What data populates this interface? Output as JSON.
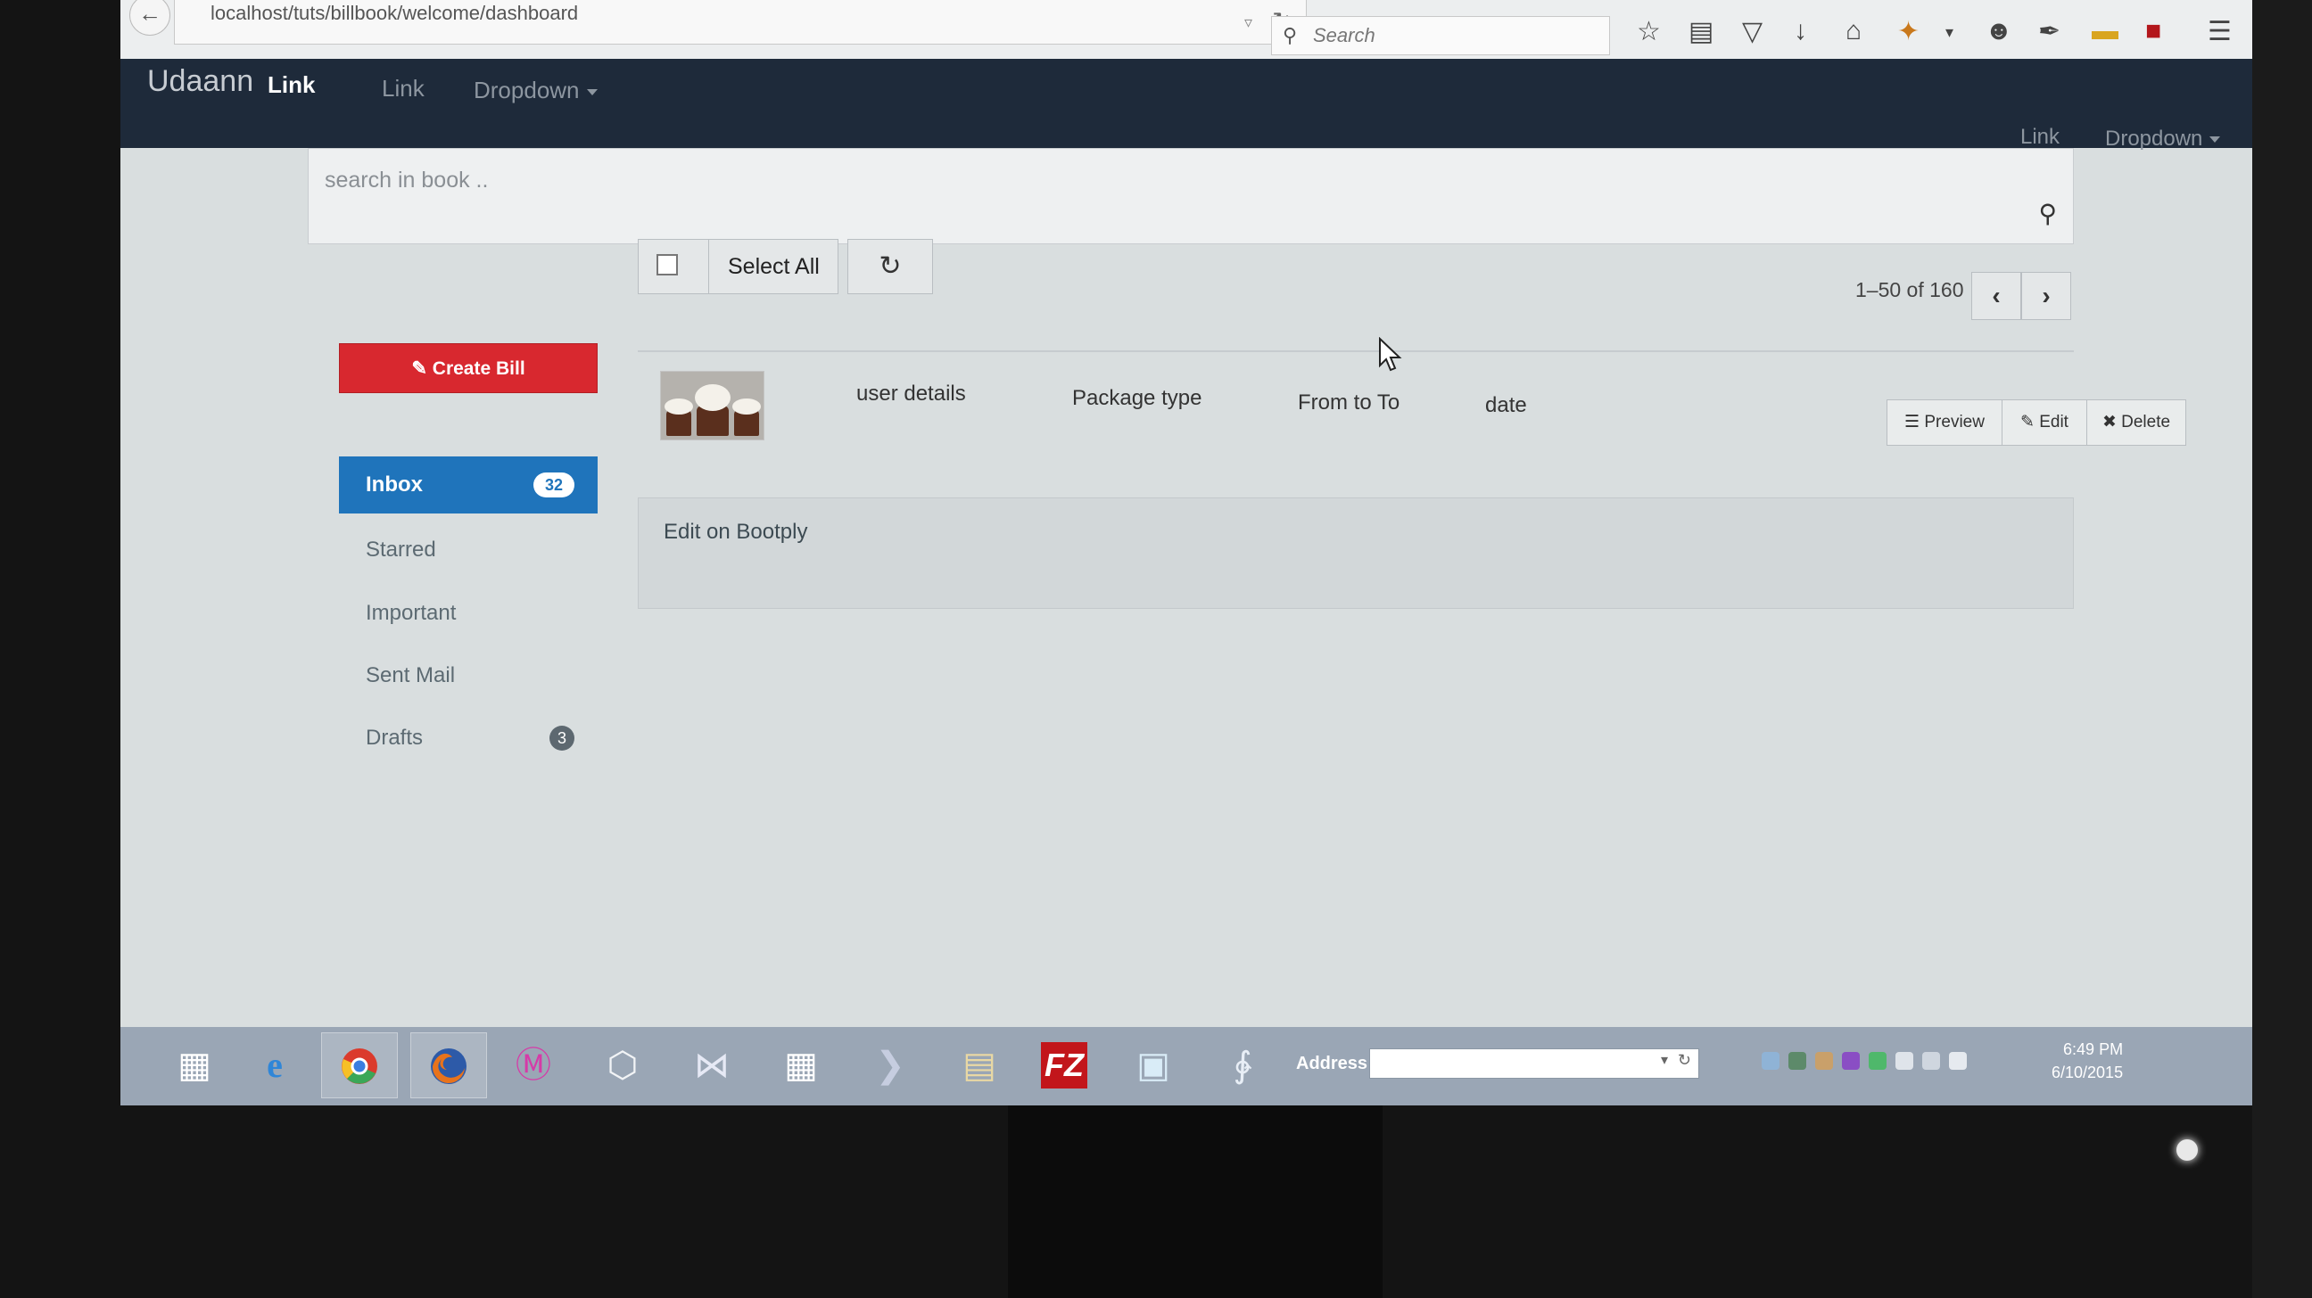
{
  "browser": {
    "url": "localhost/tuts/billbook/welcome/dashboard",
    "search_placeholder": "Search"
  },
  "navbar": {
    "brand": "Udaann",
    "links": [
      "Link",
      "Link"
    ],
    "dropdown": "Dropdown",
    "right_link": "Link",
    "right_dropdown": "Dropdown"
  },
  "search": {
    "placeholder": "search in book .."
  },
  "toolbar": {
    "select_all": "Select All",
    "pager_text": "1–50 of 160"
  },
  "sidebar": {
    "create_bill": "Create Bill",
    "items": [
      {
        "label": "Inbox",
        "badge": "32"
      },
      {
        "label": "Starred"
      },
      {
        "label": "Important"
      },
      {
        "label": "Sent Mail"
      },
      {
        "label": "Drafts",
        "badge": "3"
      }
    ]
  },
  "table": {
    "columns": [
      "user details",
      "Package type",
      "From to To",
      "date"
    ],
    "actions": {
      "preview": "Preview",
      "edit": "Edit",
      "delete": "Delete"
    }
  },
  "panel": {
    "text": "Edit on Bootply"
  },
  "taskbar": {
    "address_label": "Address",
    "time": "6:49 PM",
    "date": "6/10/2015"
  },
  "colors": {
    "navbar_bg": "#1e2a3a",
    "primary": "#1f74bb",
    "danger": "#d8282f"
  }
}
